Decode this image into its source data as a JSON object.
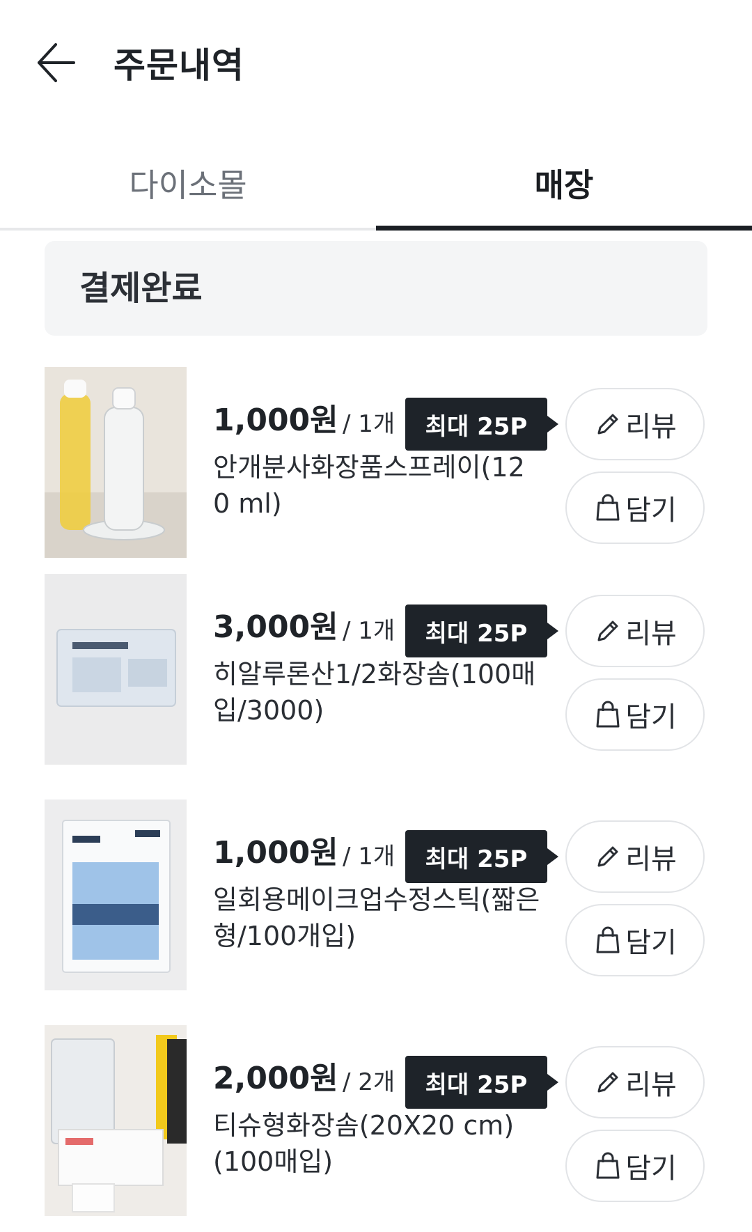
{
  "header": {
    "title": "주문내역"
  },
  "tabs": [
    {
      "label": "다이소몰",
      "active": false
    },
    {
      "label": "매장",
      "active": true
    }
  ],
  "status": {
    "label": "결제완료"
  },
  "actions": {
    "review_label": "리뷰",
    "cart_label": "담기"
  },
  "items": [
    {
      "price": "1,000원",
      "qty": "/ 1개",
      "badge": "최대 25P",
      "name": "안개분사화장품스프레이(120 ml)",
      "thumb": "spray-bottles-image"
    },
    {
      "price": "3,000원",
      "qty": "/ 1개",
      "badge": "최대 25P",
      "name": "히알루론산1/2화장솜(100매입/3000)",
      "thumb": "cotton-pad-pack-image"
    },
    {
      "price": "1,000원",
      "qty": "/ 1개",
      "badge": "최대 25P",
      "name": "일회용메이크업수정스틱(짧은형/100개입)",
      "thumb": "cotton-swab-pack-image"
    },
    {
      "price": "2,000원",
      "qty": "/ 2개",
      "badge": "최대 25P",
      "name": "티슈형화장솜(20X20 cm)(100매입)",
      "thumb": "tissue-cotton-image"
    }
  ],
  "colors": {
    "text": "#1f2328",
    "badge_bg": "#1e2329",
    "status_bg": "#f4f5f6",
    "tab_underline": "#1b1f24"
  }
}
